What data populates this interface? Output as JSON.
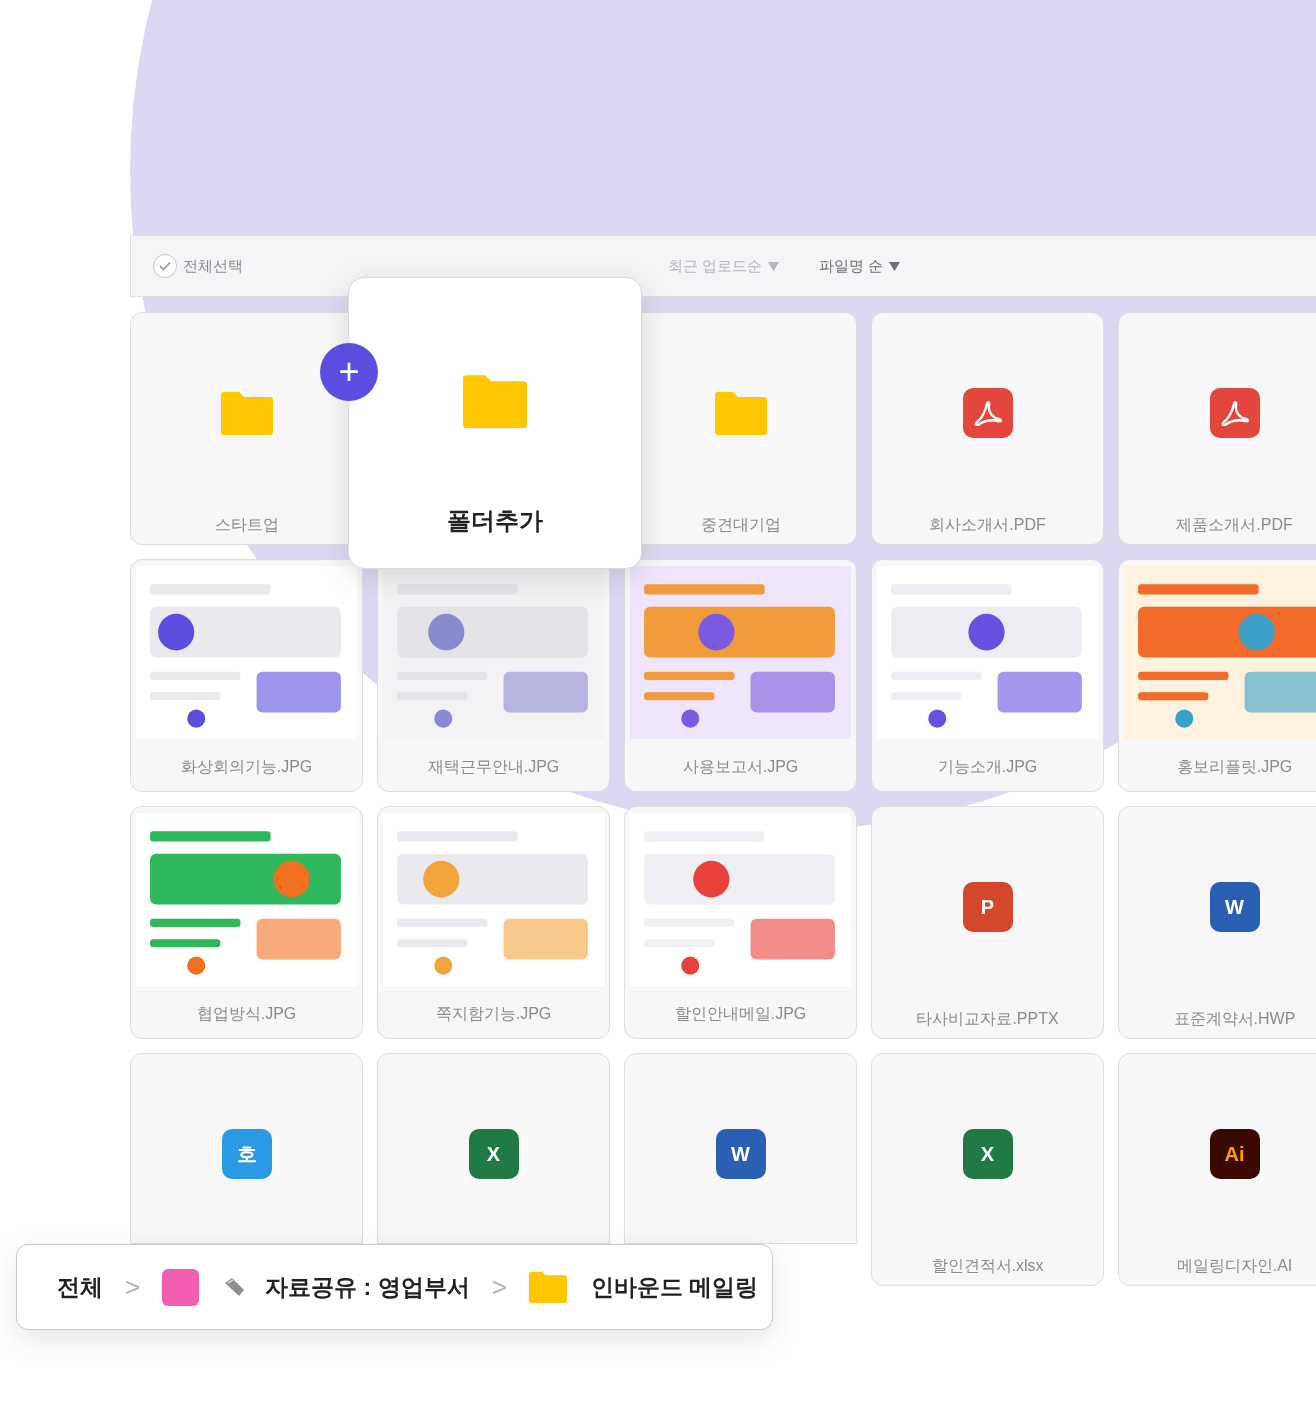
{
  "toolbar": {
    "select_all": {
      "label": "전체선택",
      "checked": true
    },
    "sorts": [
      {
        "label": "최근 업로드순",
        "selected": false
      },
      {
        "label": "파일명 순",
        "selected": true
      }
    ]
  },
  "add_folder": {
    "label": "폴더추가",
    "button": "+"
  },
  "files": [
    {
      "kind": "folder",
      "name": "스타트업"
    },
    {
      "kind": "folder",
      "name": "중견대기업"
    },
    {
      "kind": "pdf",
      "name": "회사소개서.PDF"
    },
    {
      "kind": "pdf",
      "name": "제품소개서.PDF"
    },
    {
      "name": "화상회의기능.JPG"
    },
    {
      "name": "재택근무안내.JPG"
    },
    {
      "name": "사용보고서.JPG"
    },
    {
      "name": "기능소개.JPG"
    },
    {
      "name": "홍보리플릿.JPG"
    },
    {
      "name": "협업방식.JPG"
    },
    {
      "name": "쪽지함기능.JPG"
    },
    {
      "name": "할인안내메일.JPG"
    },
    {
      "kind": "ppt",
      "name": "타사비교자료.PPTX",
      "icon_label": "P"
    },
    {
      "kind": "word",
      "name": "표준계약서.HWP",
      "icon_label": "W"
    },
    {
      "kind": "hwp",
      "icon_label": "호"
    },
    {
      "kind": "excel",
      "icon_label": "X"
    },
    {
      "kind": "word",
      "icon_label": "W"
    },
    {
      "kind": "excel",
      "name": "할인견적서.xlsx",
      "icon_label": "X"
    },
    {
      "kind": "ai",
      "name": "메일링디자인.AI",
      "icon_label": "Ai"
    }
  ],
  "breadcrumb": [
    {
      "kind": "root",
      "label": "전체"
    },
    {
      "kind": "channel",
      "label": "자료공유 : 영업부서",
      "color": "#f35fb0"
    },
    {
      "kind": "folder",
      "label": "인바운드 메일링"
    }
  ],
  "breadcrumb_separator": ">"
}
